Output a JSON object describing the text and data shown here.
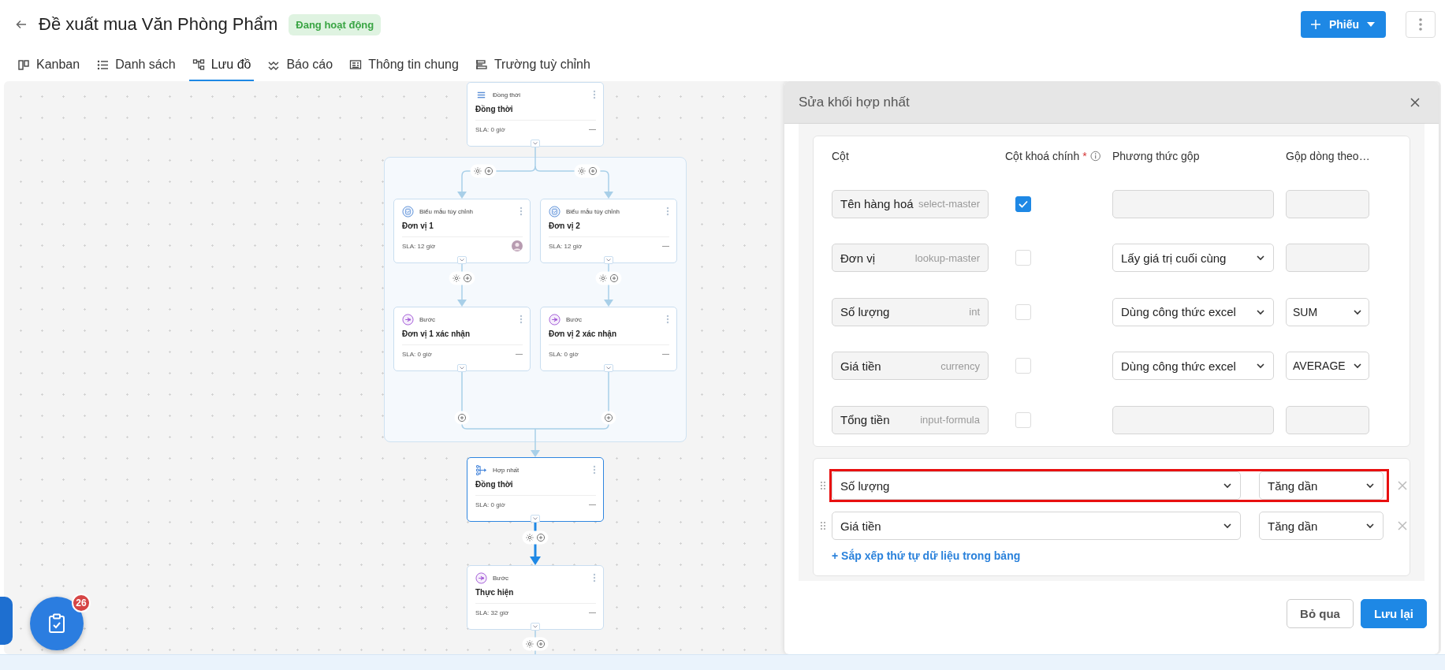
{
  "header": {
    "title": "Đề xuất mua Văn Phòng Phẩm",
    "status": "Đang hoạt động",
    "create_button": "Phiếu"
  },
  "tabs": [
    {
      "label": "Kanban",
      "selected": false
    },
    {
      "label": "Danh sách",
      "selected": false
    },
    {
      "label": "Lưu đồ",
      "selected": true
    },
    {
      "label": "Báo cáo",
      "selected": false
    },
    {
      "label": "Thông tin chung",
      "selected": false
    },
    {
      "label": "Trường tuỳ chỉnh",
      "selected": false
    }
  ],
  "flow": {
    "nodes": [
      {
        "kind": "parallel",
        "type_label": "Đồng thời",
        "title": "Đồng thời",
        "sla": "SLA: 0 giờ",
        "assignee": false,
        "selected": false
      },
      {
        "kind": "form",
        "type_label": "Biểu mẫu tùy chỉnh",
        "title": "Đơn vị 1",
        "sla": "SLA: 12 giờ",
        "assignee": true,
        "selected": false
      },
      {
        "kind": "form",
        "type_label": "Biểu mẫu tùy chỉnh",
        "title": "Đơn vị 2",
        "sla": "SLA: 12 giờ",
        "assignee": false,
        "selected": false
      },
      {
        "kind": "step",
        "type_label": "Bước",
        "title": "Đơn vị 1 xác nhận",
        "sla": "SLA: 0 giờ",
        "assignee": false,
        "selected": false
      },
      {
        "kind": "step",
        "type_label": "Bước",
        "title": "Đơn vị 2 xác nhận",
        "sla": "SLA: 0 giờ",
        "assignee": false,
        "selected": false
      },
      {
        "kind": "merge",
        "type_label": "Hợp nhất",
        "title": "Đồng thời",
        "sla": "SLA: 0 giờ",
        "assignee": false,
        "selected": true
      },
      {
        "kind": "step",
        "type_label": "Bước",
        "title": "Thực hiện",
        "sla": "SLA: 32 giờ",
        "assignee": false,
        "selected": false
      }
    ]
  },
  "task_button": {
    "badge": "26"
  },
  "panel": {
    "title": "Sửa khối hợp nhất",
    "headers": [
      {
        "label": "Cột"
      },
      {
        "label": "Cột khoá chính",
        "required_mark": "*"
      },
      {
        "label": "Phương thức gộp"
      },
      {
        "label": "Gộp dòng theo…"
      }
    ],
    "rows": [
      {
        "name": "Tên hàng hoá",
        "type": "select-master",
        "key": true,
        "method": {
          "disabled": true
        },
        "group_by": {
          "disabled": true
        }
      },
      {
        "name": "Đơn vị",
        "type": "lookup-master",
        "key": false,
        "method": {
          "value": "Lấy giá trị cuối cùng",
          "disabled": false
        },
        "group_by": {
          "disabled": true
        }
      },
      {
        "name": "Số lượng",
        "type": "int",
        "key": false,
        "method": {
          "value": "Dùng công thức excel",
          "disabled": false
        },
        "group_by": {
          "value": "SUM",
          "disabled": false
        }
      },
      {
        "name": "Giá tiền",
        "type": "currency",
        "key": false,
        "method": {
          "value": "Dùng công thức excel",
          "disabled": false
        },
        "group_by": {
          "value": "AVERAGE",
          "disabled": false
        }
      },
      {
        "name": "Tổng tiền",
        "type": "input-formula",
        "key": false,
        "method": {
          "disabled": true
        },
        "group_by": {
          "disabled": true
        }
      }
    ],
    "sort": {
      "rows": [
        {
          "field": "Số lượng",
          "order": "Tăng dần",
          "highlighted": true
        },
        {
          "field": "Giá tiền",
          "order": "Tăng dần",
          "highlighted": false
        }
      ],
      "add_link": "+ Sắp xếp thứ tự dữ liệu trong bảng"
    },
    "buttons": [
      {
        "label": "Bỏ qua",
        "kind": "secondary"
      },
      {
        "label": "Lưu lại",
        "kind": "primary"
      }
    ]
  }
}
